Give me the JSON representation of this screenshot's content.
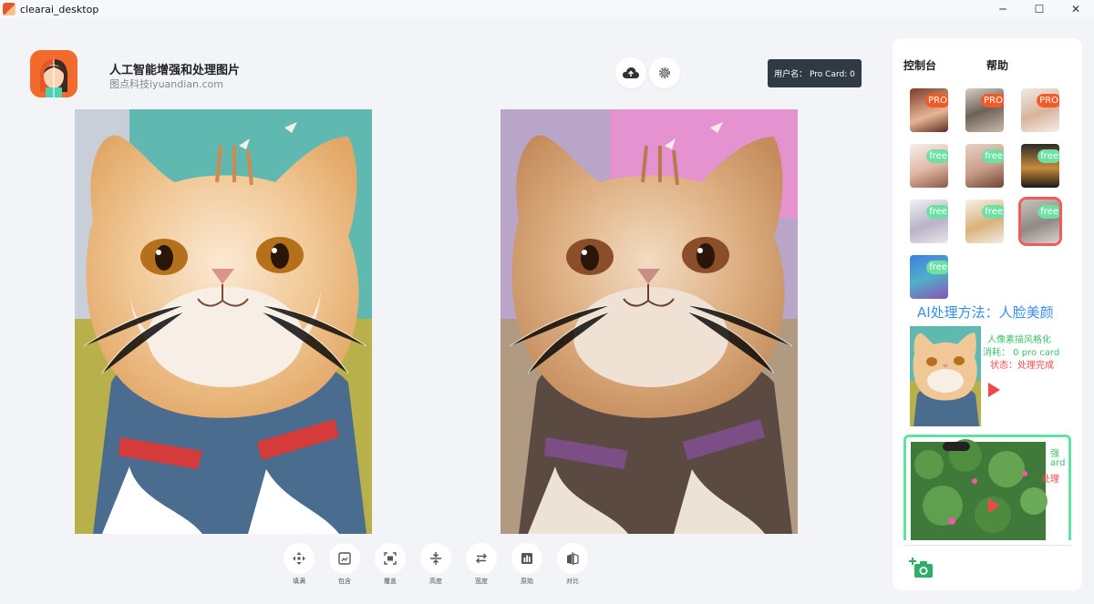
{
  "window": {
    "title": "clearai_desktop",
    "minimize": "─",
    "maximize": "☐",
    "close": "✕"
  },
  "header": {
    "app_name": "人工智能增强和处理图片",
    "app_subtitle": "图点科技iyuandian.com",
    "user_badge": "用户名： Pro Card: 0"
  },
  "toolbar": [
    {
      "id": "fill",
      "label": "填满",
      "icon": "move-icon"
    },
    {
      "id": "contain",
      "label": "包含",
      "icon": "fit-icon"
    },
    {
      "id": "cover",
      "label": "覆盖",
      "icon": "cover-icon"
    },
    {
      "id": "height",
      "label": "高度",
      "icon": "height-icon"
    },
    {
      "id": "width",
      "label": "宽度",
      "icon": "width-icon"
    },
    {
      "id": "original",
      "label": "原始",
      "icon": "original-icon"
    },
    {
      "id": "compare",
      "label": "对比",
      "icon": "compare-icon"
    }
  ],
  "panel": {
    "tabs": [
      "控制台",
      "帮助"
    ],
    "thumbnails": [
      {
        "badge": "PRO",
        "type": "pro"
      },
      {
        "badge": "PRO",
        "type": "pro"
      },
      {
        "badge": "PRO",
        "type": "pro"
      },
      {
        "badge": "free",
        "type": "free"
      },
      {
        "badge": "free",
        "type": "free"
      },
      {
        "badge": "free",
        "type": "free"
      },
      {
        "badge": "free",
        "type": "free"
      },
      {
        "badge": "free",
        "type": "free"
      },
      {
        "badge": "free",
        "type": "free",
        "selected": true
      },
      {
        "badge": "free",
        "type": "free"
      }
    ],
    "method_title": "AI处理方法：人脸美颜",
    "result1": {
      "method": "：人像素描风格化",
      "cost": "消耗： 0 pro card",
      "status": "状态：处理完成"
    },
    "result2": {
      "method": "强",
      "cost": "ard",
      "status": "处理"
    }
  },
  "colors": {
    "pro": "#f25a28",
    "free": "#6ee0a4",
    "accent_blue": "#3a8ee8",
    "status_red": "#ef4a4a",
    "selected_outline": "#ef5b5b"
  }
}
